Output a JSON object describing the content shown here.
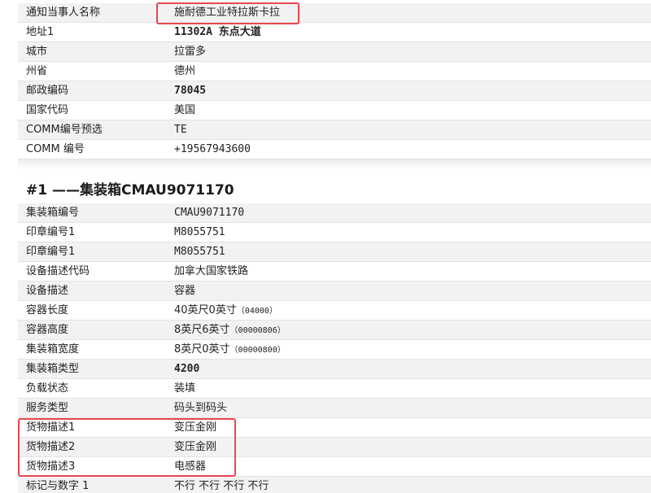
{
  "colors": {
    "highlight": "#e8474f",
    "row_shade": "#f2f2f2",
    "border": "#e3e3e3"
  },
  "notify": {
    "rows": [
      {
        "label": "通知当事人名称",
        "value": "施耐德工业特拉斯卡拉"
      },
      {
        "label": "地址1",
        "value": "11302A 东点大道"
      },
      {
        "label": "城市",
        "value": "拉雷多"
      },
      {
        "label": "州省",
        "value": "德州"
      },
      {
        "label": "邮政编码",
        "value": "78045"
      },
      {
        "label": "国家代码",
        "value": "美国"
      },
      {
        "label": "COMM编号预选",
        "value": "TE"
      },
      {
        "label": "COMM 编号",
        "value": "+19567943600"
      }
    ]
  },
  "container": {
    "title": "#1 ——集装箱CMAU9071170",
    "rows": [
      {
        "label": "集装箱编号",
        "value": "CMAU9071170"
      },
      {
        "label": "印章编号1",
        "value": "M8055751"
      },
      {
        "label": "印章编号1",
        "value": "M8055751"
      },
      {
        "label": "设备描述代码",
        "value": "加拿大国家铁路"
      },
      {
        "label": "设备描述",
        "value": "容器"
      },
      {
        "label": "容器长度",
        "value_main": "40英尺0英寸",
        "value_code": "（04000）"
      },
      {
        "label": "容器高度",
        "value_main": "8英尺6英寸",
        "value_code": "（00000806）"
      },
      {
        "label": "集装箱宽度",
        "value_main": "8英尺0英寸",
        "value_code": "（00000800）"
      },
      {
        "label": "集装箱类型",
        "value": "4200"
      },
      {
        "label": "负载状态",
        "value": "装填"
      },
      {
        "label": "服务类型",
        "value": "码头到码头"
      },
      {
        "label": "货物描述1",
        "value": "变压金刚"
      },
      {
        "label": "货物描述2",
        "value": "变压金刚"
      },
      {
        "label": "货物描述3",
        "value": "电感器"
      },
      {
        "label": "标记与数字 1",
        "value": "不行 不行 不行 不行"
      }
    ]
  }
}
